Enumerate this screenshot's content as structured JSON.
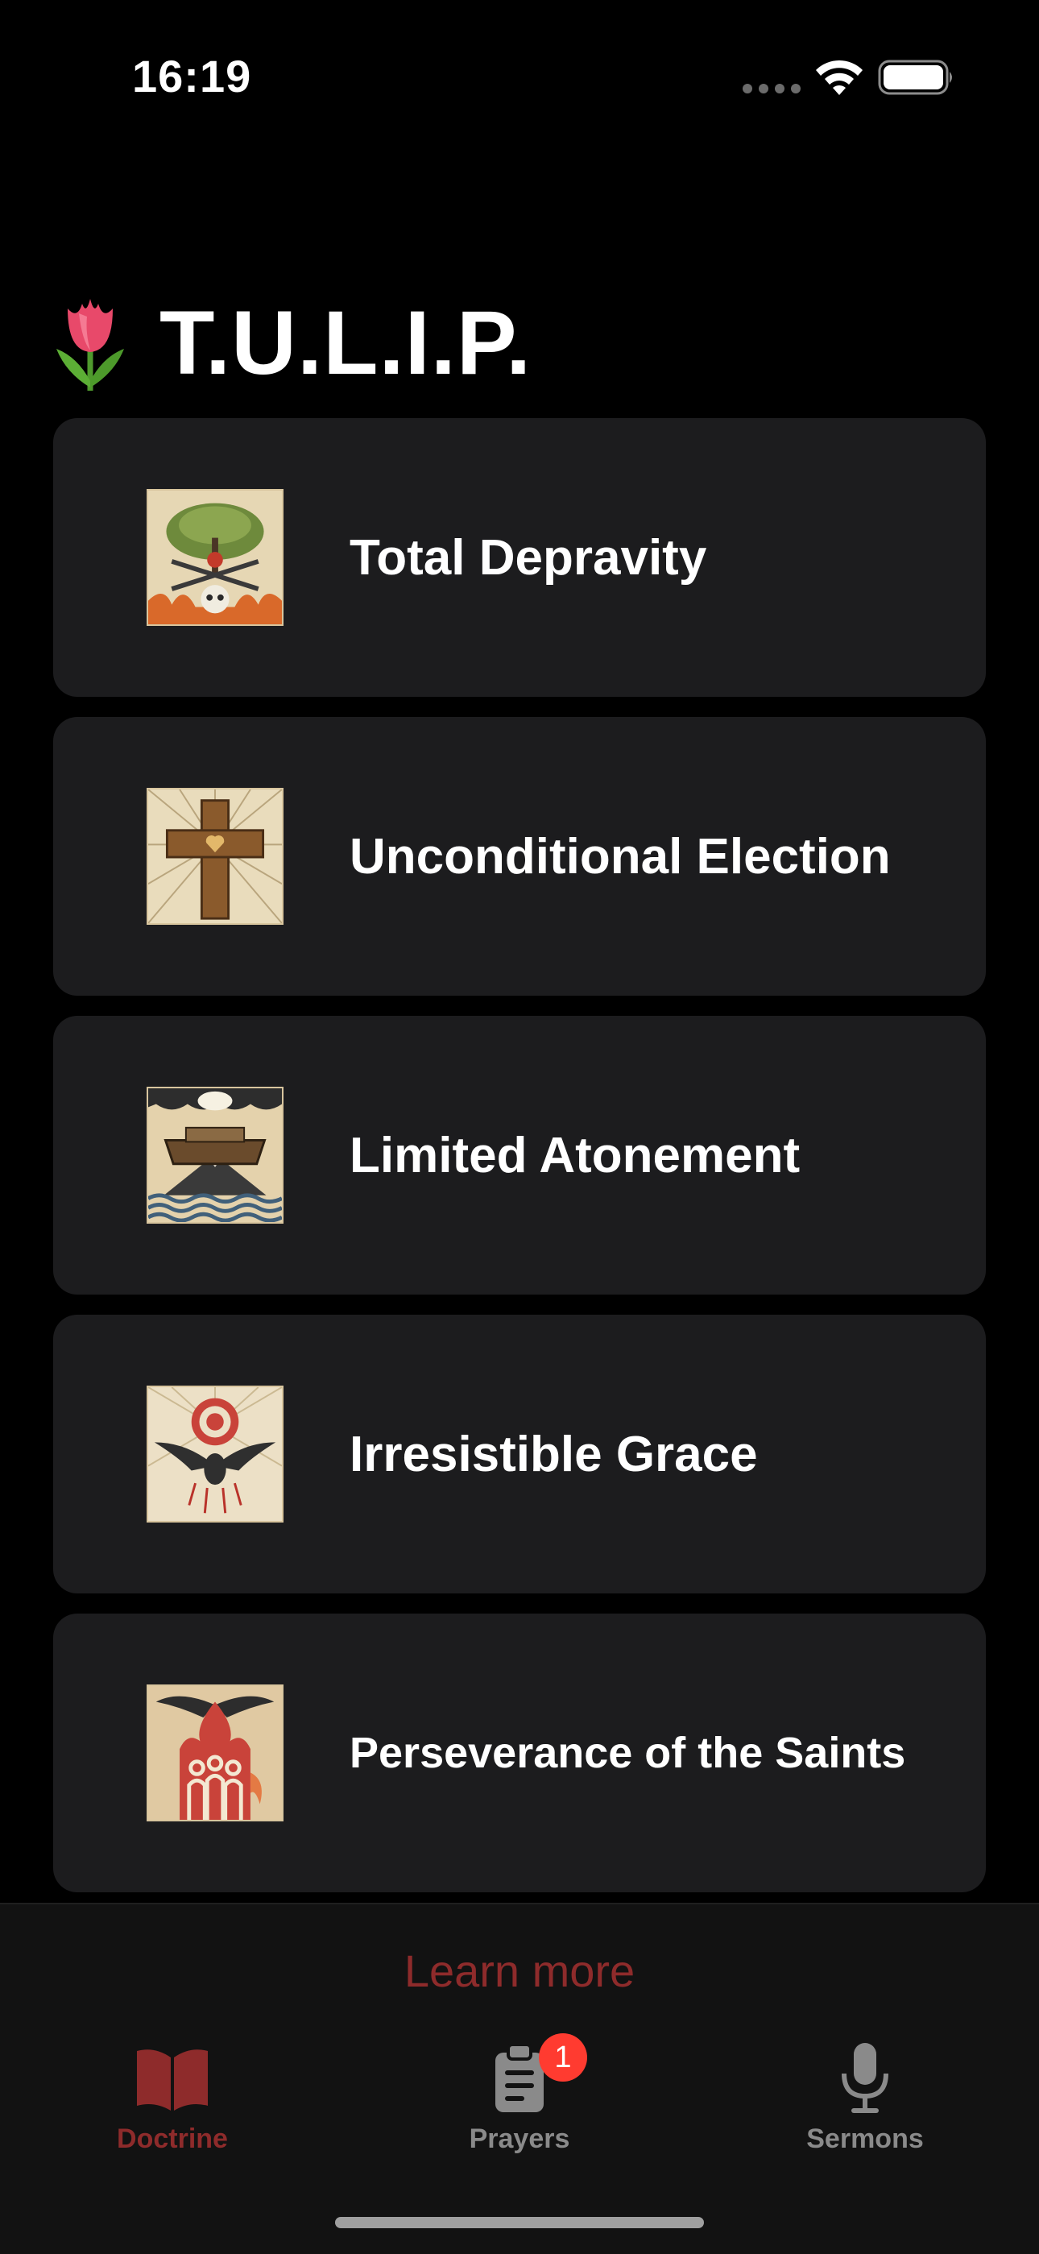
{
  "status_bar": {
    "time": "16:19",
    "wifi_icon": "wifi-icon",
    "battery_icon": "battery-icon"
  },
  "header": {
    "icon": "tulip-icon",
    "title": "T.U.L.I.P."
  },
  "cards": [
    {
      "label": "Total Depravity",
      "icon": "tree-skull-icon"
    },
    {
      "label": "Unconditional Election",
      "icon": "cross-heart-icon"
    },
    {
      "label": "Limited Atonement",
      "icon": "ark-icon"
    },
    {
      "label": "Irresistible Grace",
      "icon": "dove-flower-icon"
    },
    {
      "label": "Perseverance of the Saints",
      "icon": "flame-saints-icon"
    }
  ],
  "footer": {
    "learn_more": "Learn more"
  },
  "tabs": [
    {
      "label": "Doctrine",
      "icon": "book-icon",
      "selected": true
    },
    {
      "label": "Prayers",
      "icon": "clipboard-icon",
      "badge": "1"
    },
    {
      "label": "Sermons",
      "icon": "microphone-icon"
    }
  ],
  "colors": {
    "background": "#000000",
    "card": "#1c1c1e",
    "accent": "#8e2b2b",
    "badge": "#ff3b30",
    "inactive_tab": "#8a8a8a"
  }
}
